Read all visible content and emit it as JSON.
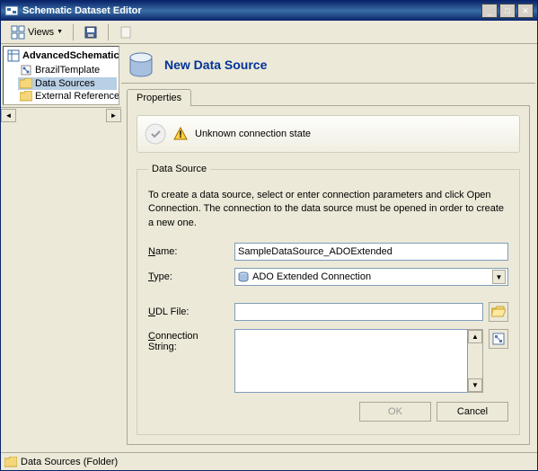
{
  "window": {
    "title": "Schematic Dataset Editor"
  },
  "toolbar": {
    "views_label": "Views"
  },
  "tree": {
    "root": "AdvancedSchematic",
    "items": [
      {
        "label": "BrazilTemplate",
        "icon": "schematic"
      },
      {
        "label": "Data Sources",
        "icon": "folder",
        "selected": true
      },
      {
        "label": "External References",
        "icon": "folder"
      }
    ]
  },
  "header": {
    "title": "New Data Source"
  },
  "tabs": {
    "properties": "Properties"
  },
  "status": {
    "text": "Unknown connection state"
  },
  "fieldset": {
    "legend": "Data Source",
    "help": "To create a data source, select or enter connection parameters and click Open Connection.  The connection to the data source must be opened in order to create a new one.",
    "name_label": "Name:",
    "name_value": "SampleDataSource_ADOExtended",
    "type_label": "Type:",
    "type_value": "ADO Extended Connection",
    "udl_label": "UDL File:",
    "udl_value": "",
    "conn_label": "Connection String:",
    "conn_value": ""
  },
  "buttons": {
    "ok": "OK",
    "cancel": "Cancel"
  },
  "statusbar": {
    "text": "Data Sources (Folder)"
  }
}
